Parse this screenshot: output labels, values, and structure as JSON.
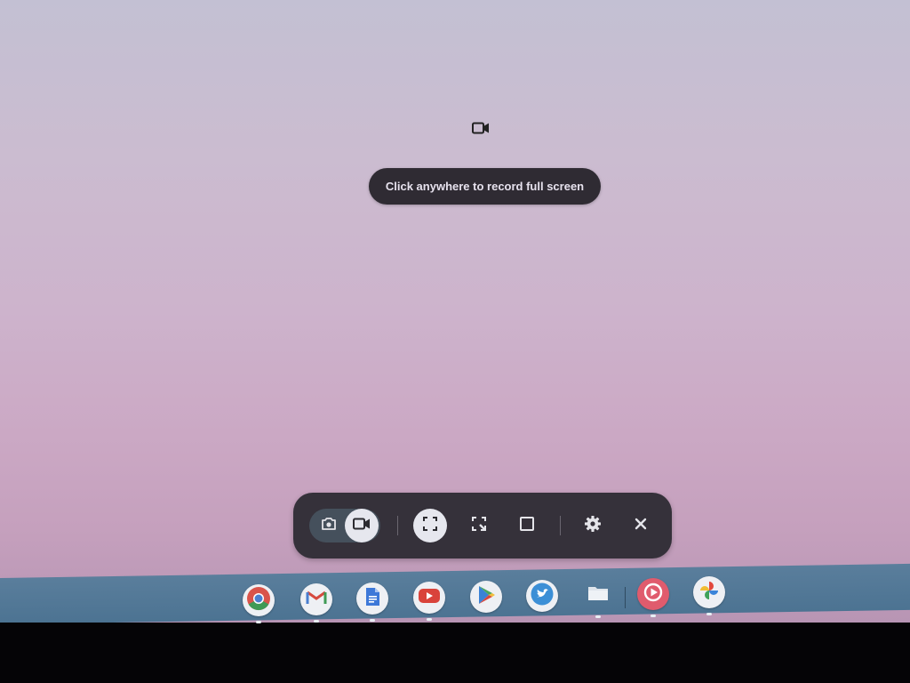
{
  "hint": {
    "text": "Click anywhere to record full screen"
  },
  "capture_mode_indicator": {
    "icon": "videocam-icon"
  },
  "capture_bar": {
    "type_toggle": [
      {
        "name": "screenshot",
        "icon": "camera-icon",
        "selected": false
      },
      {
        "name": "screen-record",
        "icon": "videocam-icon",
        "selected": true
      }
    ],
    "source_buttons": [
      {
        "name": "fullscreen",
        "icon": "fullscreen-icon",
        "selected": true
      },
      {
        "name": "partial",
        "icon": "partial-select-icon",
        "selected": false
      },
      {
        "name": "window",
        "icon": "window-icon",
        "selected": false
      }
    ],
    "settings_icon": "gear-icon",
    "close_icon": "close-icon"
  },
  "shelf": {
    "apps": [
      {
        "name": "chrome",
        "icon": "chrome-icon"
      },
      {
        "name": "gmail",
        "icon": "gmail-icon"
      },
      {
        "name": "docs",
        "icon": "docs-icon"
      },
      {
        "name": "youtube",
        "icon": "youtube-icon"
      },
      {
        "name": "play-store",
        "icon": "play-store-icon"
      },
      {
        "name": "twitter",
        "icon": "twitter-icon"
      },
      {
        "name": "files",
        "icon": "files-icon"
      },
      {
        "name": "youtube-music",
        "icon": "youtube-music-icon"
      },
      {
        "name": "google-photos",
        "icon": "photos-icon"
      }
    ]
  },
  "colors": {
    "toast_bg": "#2f2b33",
    "bar_bg": "#35313a",
    "active_button": "#e6e7ee",
    "shelf": "#4f7593"
  }
}
